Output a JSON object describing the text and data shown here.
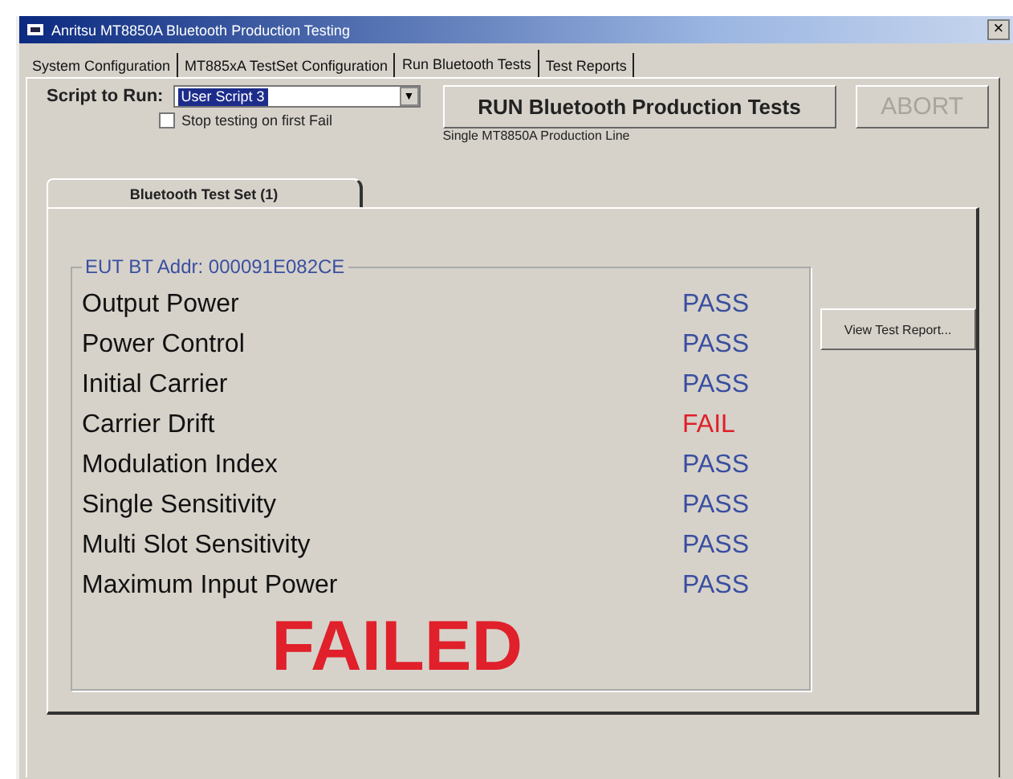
{
  "window": {
    "title": "Anritsu MT8850A Bluetooth Production Testing",
    "close": "×"
  },
  "tabs": [
    {
      "label": "System Configuration",
      "selected": false
    },
    {
      "label": "MT885xA TestSet Configuration",
      "selected": false
    },
    {
      "label": "Run Bluetooth Tests",
      "selected": true
    },
    {
      "label": "Test Reports",
      "selected": false
    }
  ],
  "script": {
    "label": "Script to Run:",
    "value": "User Script 3",
    "arrow": "▼"
  },
  "stop_on_fail": {
    "label": "Stop testing on first Fail",
    "checked": false
  },
  "run_button": {
    "label": "RUN Bluetooth Production Tests",
    "disabled": false
  },
  "abort_button": {
    "label": "ABORT",
    "disabled": true
  },
  "line_note": "Single MT8850A Production Line",
  "set_tabs": [
    {
      "label": "Bluetooth Test Set (1)",
      "selected": true
    }
  ],
  "group_title": "EUT BT Addr: 000091E082CE",
  "results": [
    {
      "name": "Output Power",
      "result": "PASS",
      "kind": "pass"
    },
    {
      "name": "Power Control",
      "result": "PASS",
      "kind": "pass"
    },
    {
      "name": "Initial Carrier",
      "result": "PASS",
      "kind": "pass"
    },
    {
      "name": "Carrier Drift",
      "result": "FAIL",
      "kind": "fail"
    },
    {
      "name": "Modulation Index",
      "result": "PASS",
      "kind": "pass"
    },
    {
      "name": "Single Sensitivity",
      "result": "PASS",
      "kind": "pass"
    },
    {
      "name": "Multi Slot Sensitivity",
      "result": "PASS",
      "kind": "pass"
    },
    {
      "name": "Maximum Input Power",
      "result": "PASS",
      "kind": "pass"
    }
  ],
  "overall": {
    "text": "FAILED",
    "kind": "fail"
  },
  "view_report_button": {
    "label": "View Test Report..."
  }
}
